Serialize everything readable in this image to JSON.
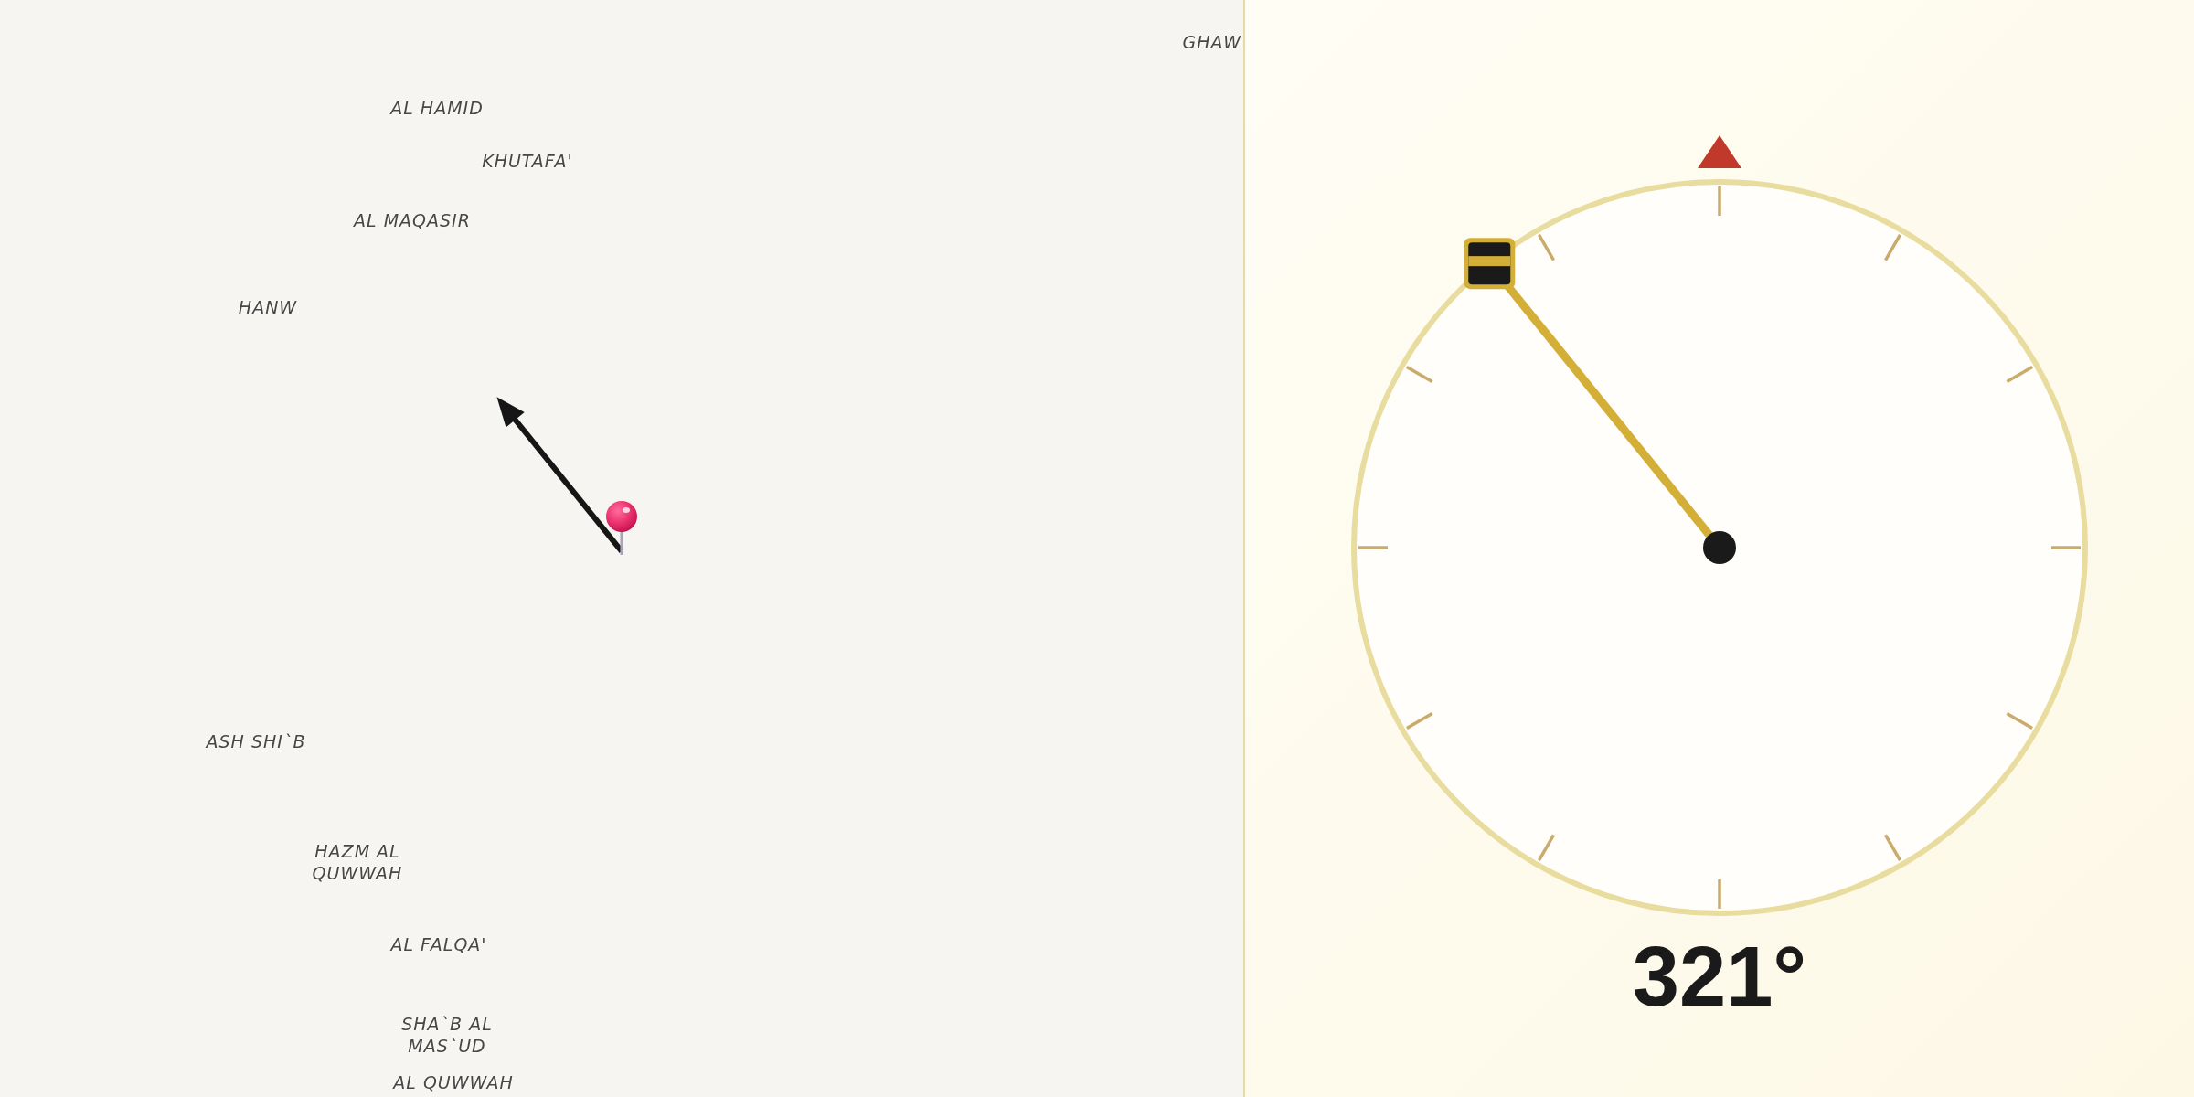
{
  "map": {
    "labels": [
      "GHAW",
      "AL HAMID",
      "KHUTAFA'",
      "AL MAQASIR",
      "HANW",
      "ASH SHI`B",
      "HAZM AL QUWWAH",
      "AL FALQA'",
      "SHA`B AL MAS`UD",
      "AL QUWWAH"
    ]
  },
  "compass": {
    "bearing": "321°"
  }
}
